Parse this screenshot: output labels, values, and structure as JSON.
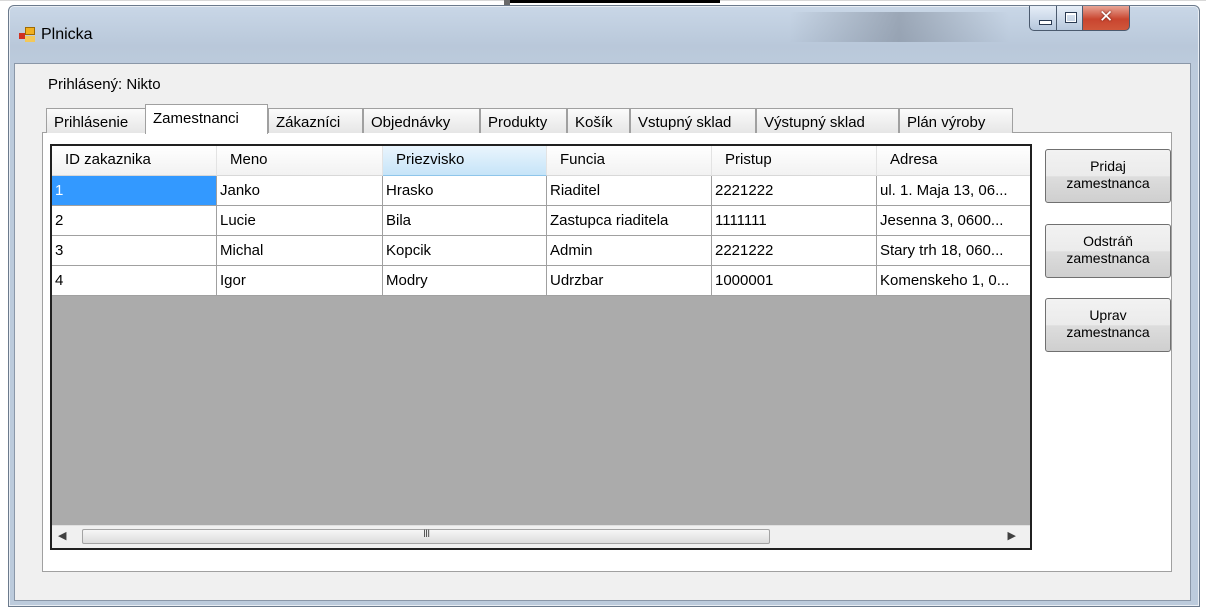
{
  "window": {
    "title": "Plnicka"
  },
  "logged_in_label": "Prihlásený: Nikto",
  "tabs": [
    {
      "label": "Prihlásenie"
    },
    {
      "label": "Zamestnanci"
    },
    {
      "label": "Zákazníci"
    },
    {
      "label": "Objednávky"
    },
    {
      "label": "Produkty"
    },
    {
      "label": "Košík"
    },
    {
      "label": "Vstupný sklad"
    },
    {
      "label": "Výstupný sklad"
    },
    {
      "label": "Plán výroby"
    }
  ],
  "grid": {
    "columns": [
      "ID zakaznika",
      "Meno",
      "Priezvisko",
      "Funcia",
      "Pristup",
      "Adresa"
    ],
    "rows": [
      [
        "1",
        "Janko",
        "Hrasko",
        "Riaditel",
        "2221222",
        "ul. 1. Maja 13, 06..."
      ],
      [
        "2",
        "Lucie",
        "Bila",
        "Zastupca riaditela",
        "1111111",
        "Jesenna 3, 0600..."
      ],
      [
        "3",
        "Michal",
        "Kopcik",
        "Admin",
        "2221222",
        "Stary trh 18, 060..."
      ],
      [
        "4",
        "Igor",
        "Modry",
        "Udrzbar",
        "1000001",
        "Komenskeho 1, 0..."
      ]
    ],
    "scroll_thumb_glyph": "III"
  },
  "buttons": {
    "add": [
      "Pridaj",
      "zamestnanca"
    ],
    "remove": [
      "Odstráň",
      "zamestnanca"
    ],
    "edit": [
      "Uprav",
      "zamestnanca"
    ]
  }
}
